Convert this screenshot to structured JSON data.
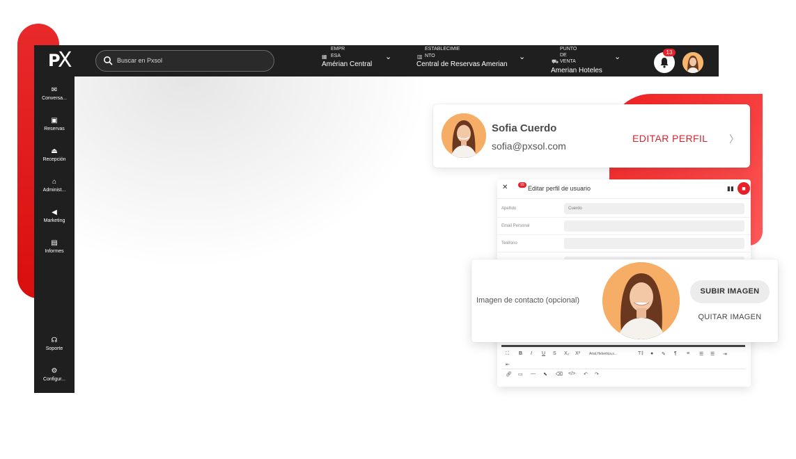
{
  "topbar": {
    "logo": "PX",
    "search_placeholder": "Buscar en Pxsol",
    "empresa": {
      "caption_1": "EMPR",
      "caption_2": "ESA",
      "value": "Amérian Central"
    },
    "establecimiento": {
      "caption_1": "ESTABLECIMIE",
      "caption_2": "NTO",
      "value": "Central de Reservas Amerian"
    },
    "punto_venta": {
      "caption_1": "PUNTO",
      "caption_2": "DE",
      "caption_3": "VENTA",
      "value": "Amerian Hoteles"
    },
    "notifications_count": "13"
  },
  "sidebar": {
    "items": [
      {
        "label": "Conversa...",
        "icon": "mail-icon"
      },
      {
        "label": "Reservas",
        "icon": "calendar-icon"
      },
      {
        "label": "Recepción",
        "icon": "bell-service-icon"
      },
      {
        "label": "Administ...",
        "icon": "bank-icon"
      },
      {
        "label": "Marketing",
        "icon": "megaphone-icon"
      },
      {
        "label": "Informes",
        "icon": "report-icon"
      }
    ],
    "bottom": [
      {
        "label": "Soporte",
        "icon": "support-icon"
      },
      {
        "label": "Configur...",
        "icon": "gear-icon"
      }
    ]
  },
  "profile_card": {
    "name": "Sofia Cuerdo",
    "email": "sofia@pxsol.com",
    "edit_label": "EDITAR PERFIL"
  },
  "edit_panel": {
    "title": "Editar perfil de usuario",
    "mini_badge": "99",
    "rows": [
      {
        "label": "Apellido",
        "value": "Cuerdo"
      },
      {
        "label": "Email Personal",
        "value": ""
      },
      {
        "label": "Teléfono",
        "value": ""
      }
    ],
    "font_select": "Arial,Helvetica,s..."
  },
  "image_card": {
    "label": "Imagen de contacto (opcional)",
    "upload_label": "SUBIR IMAGEN",
    "remove_label": "QUITAR IMAGEN"
  },
  "colors": {
    "brand_red": "#e8202a",
    "bar_dark": "#1f1f1f",
    "avatar_bg": "#f6ae67"
  }
}
